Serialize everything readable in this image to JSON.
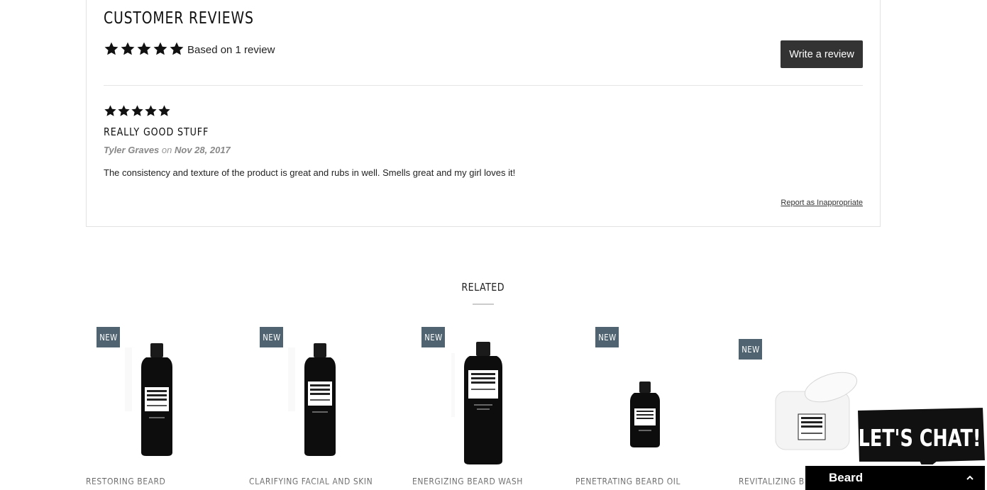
{
  "reviews": {
    "title": "CUSTOMER REVIEWS",
    "summary_rating": 5,
    "summary_text": "Based on 1 review",
    "write_button": "Write a review",
    "items": [
      {
        "rating": 5,
        "title": "REALLY GOOD STUFF",
        "author": "Tyler Graves",
        "on_word": "on",
        "date": "Nov 28, 2017",
        "body": "The consistency and texture of the product is great and rubs in well. Smells great and my girl loves it!",
        "report_link": "Report as Inappropriate"
      }
    ]
  },
  "related": {
    "title": "RELATED",
    "products": [
      {
        "badge": "NEW",
        "name": "RESTORING BEARD CONDITIONER",
        "image_icon": "bottle-icon"
      },
      {
        "badge": "NEW",
        "name": "CLARIFYING FACIAL AND SKIN ASTRINGENT",
        "image_icon": "bottle-icon"
      },
      {
        "badge": "NEW",
        "name": "ENERGIZING BEARD WASH",
        "image_icon": "bottle-icon"
      },
      {
        "badge": "NEW",
        "name": "PENETRATING BEARD OIL",
        "image_icon": "small-bottle-icon"
      },
      {
        "badge": "NEW",
        "name": "REVITALIZING BEA",
        "image_icon": "jar-icon"
      }
    ]
  },
  "chat": {
    "bubble_text": "LET'S CHAT!",
    "bar_label": "Beard"
  },
  "colors": {
    "badge": "#4f6470",
    "button": "#333333",
    "chat_bar": "#000000"
  }
}
